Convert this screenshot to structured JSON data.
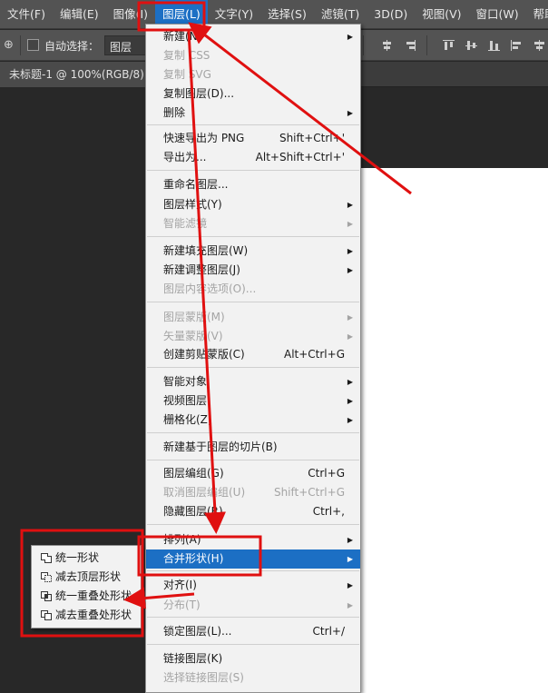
{
  "menubar": {
    "items": [
      "文件(F)",
      "编辑(E)",
      "图像(I)",
      "图层(L)",
      "文字(Y)",
      "选择(S)",
      "滤镜(T)",
      "3D(D)",
      "视图(V)",
      "窗口(W)",
      "帮助(H)"
    ]
  },
  "options_bar": {
    "auto_select_label": "自动选择：",
    "target_select": "图层"
  },
  "document_tab": {
    "title": "未标题-1 @ 100%(RGB/8) *"
  },
  "layer_menu": {
    "items": [
      {
        "label": "新建(N)",
        "shortcut": "",
        "submenu": true,
        "disabled": false
      },
      {
        "label": "复制 CSS",
        "shortcut": "",
        "submenu": false,
        "disabled": true
      },
      {
        "label": "复制 SVG",
        "shortcut": "",
        "submenu": false,
        "disabled": true
      },
      {
        "label": "复制图层(D)...",
        "shortcut": "",
        "submenu": false,
        "disabled": false
      },
      {
        "label": "删除",
        "shortcut": "",
        "submenu": true,
        "disabled": false
      },
      {
        "label": "快速导出为 PNG",
        "shortcut": "Shift+Ctrl+'",
        "submenu": false,
        "disabled": false
      },
      {
        "label": "导出为...",
        "shortcut": "Alt+Shift+Ctrl+'",
        "submenu": false,
        "disabled": false
      },
      {
        "label": "重命名图层...",
        "shortcut": "",
        "submenu": false,
        "disabled": false
      },
      {
        "label": "图层样式(Y)",
        "shortcut": "",
        "submenu": true,
        "disabled": false
      },
      {
        "label": "智能滤镜",
        "shortcut": "",
        "submenu": true,
        "disabled": true
      },
      {
        "label": "新建填充图层(W)",
        "shortcut": "",
        "submenu": true,
        "disabled": false
      },
      {
        "label": "新建调整图层(J)",
        "shortcut": "",
        "submenu": true,
        "disabled": false
      },
      {
        "label": "图层内容选项(O)...",
        "shortcut": "",
        "submenu": false,
        "disabled": true
      },
      {
        "label": "图层蒙版(M)",
        "shortcut": "",
        "submenu": true,
        "disabled": true
      },
      {
        "label": "矢量蒙版(V)",
        "shortcut": "",
        "submenu": true,
        "disabled": true
      },
      {
        "label": "创建剪贴蒙版(C)",
        "shortcut": "Alt+Ctrl+G",
        "submenu": false,
        "disabled": false
      },
      {
        "label": "智能对象",
        "shortcut": "",
        "submenu": true,
        "disabled": false
      },
      {
        "label": "视频图层",
        "shortcut": "",
        "submenu": true,
        "disabled": false
      },
      {
        "label": "栅格化(Z)",
        "shortcut": "",
        "submenu": true,
        "disabled": false
      },
      {
        "label": "新建基于图层的切片(B)",
        "shortcut": "",
        "submenu": false,
        "disabled": false
      },
      {
        "label": "图层编组(G)",
        "shortcut": "Ctrl+G",
        "submenu": false,
        "disabled": false
      },
      {
        "label": "取消图层编组(U)",
        "shortcut": "Shift+Ctrl+G",
        "submenu": false,
        "disabled": true
      },
      {
        "label": "隐藏图层(R)",
        "shortcut": "Ctrl+,",
        "submenu": false,
        "disabled": false
      },
      {
        "label": "排列(A)",
        "shortcut": "",
        "submenu": true,
        "disabled": false
      },
      {
        "label": "合并形状(H)",
        "shortcut": "",
        "submenu": true,
        "disabled": false,
        "highlighted": true
      },
      {
        "label": "对齐(I)",
        "shortcut": "",
        "submenu": true,
        "disabled": false
      },
      {
        "label": "分布(T)",
        "shortcut": "",
        "submenu": true,
        "disabled": true
      },
      {
        "label": "锁定图层(L)...",
        "shortcut": "Ctrl+/",
        "submenu": false,
        "disabled": false
      },
      {
        "label": "链接图层(K)",
        "shortcut": "",
        "submenu": false,
        "disabled": false
      },
      {
        "label": "选择链接图层(S)",
        "shortcut": "",
        "submenu": false,
        "disabled": true
      }
    ]
  },
  "combine_shapes_submenu": {
    "items": [
      {
        "label": "统一形状",
        "icon": "unite-shapes-icon"
      },
      {
        "label": "减去顶层形状",
        "icon": "subtract-front-shape-icon"
      },
      {
        "label": "统一重叠处形状",
        "icon": "intersect-shapes-icon"
      },
      {
        "label": "减去重叠处形状",
        "icon": "exclude-overlap-icon"
      }
    ]
  },
  "colors": {
    "menubar_bg": "#535353",
    "highlight": "#1c6fc4",
    "menu_bg": "#f2f2f2",
    "annotation_red": "#e01010"
  }
}
